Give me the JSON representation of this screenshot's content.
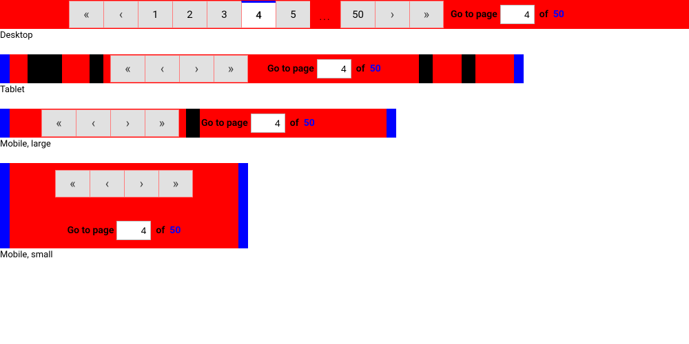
{
  "labels": {
    "desktop": "Desktop",
    "tablet": "Tablet",
    "mobile_large": "Mobile, large",
    "mobile_small": "Mobile, small"
  },
  "chevrons": {
    "first": "«",
    "prev": "‹",
    "next": "›",
    "last": "»"
  },
  "desktop": {
    "pages": [
      "1",
      "2",
      "3",
      "4",
      "5"
    ],
    "ellipsis": "...",
    "last_page": "50",
    "active_index": 3,
    "goto_label": "Go to page",
    "goto_value": "4",
    "goto_of": "of",
    "goto_total": "50"
  },
  "tablet": {
    "goto_label": "Go to page",
    "goto_value": "4",
    "goto_of": "of",
    "goto_total": "50"
  },
  "mobile_large": {
    "goto_label": "Go to page",
    "goto_value": "4",
    "goto_of": "of",
    "goto_total": "50"
  },
  "mobile_small": {
    "goto_label": "Go to page",
    "goto_value": "4",
    "goto_of": "of",
    "goto_total": "50"
  }
}
